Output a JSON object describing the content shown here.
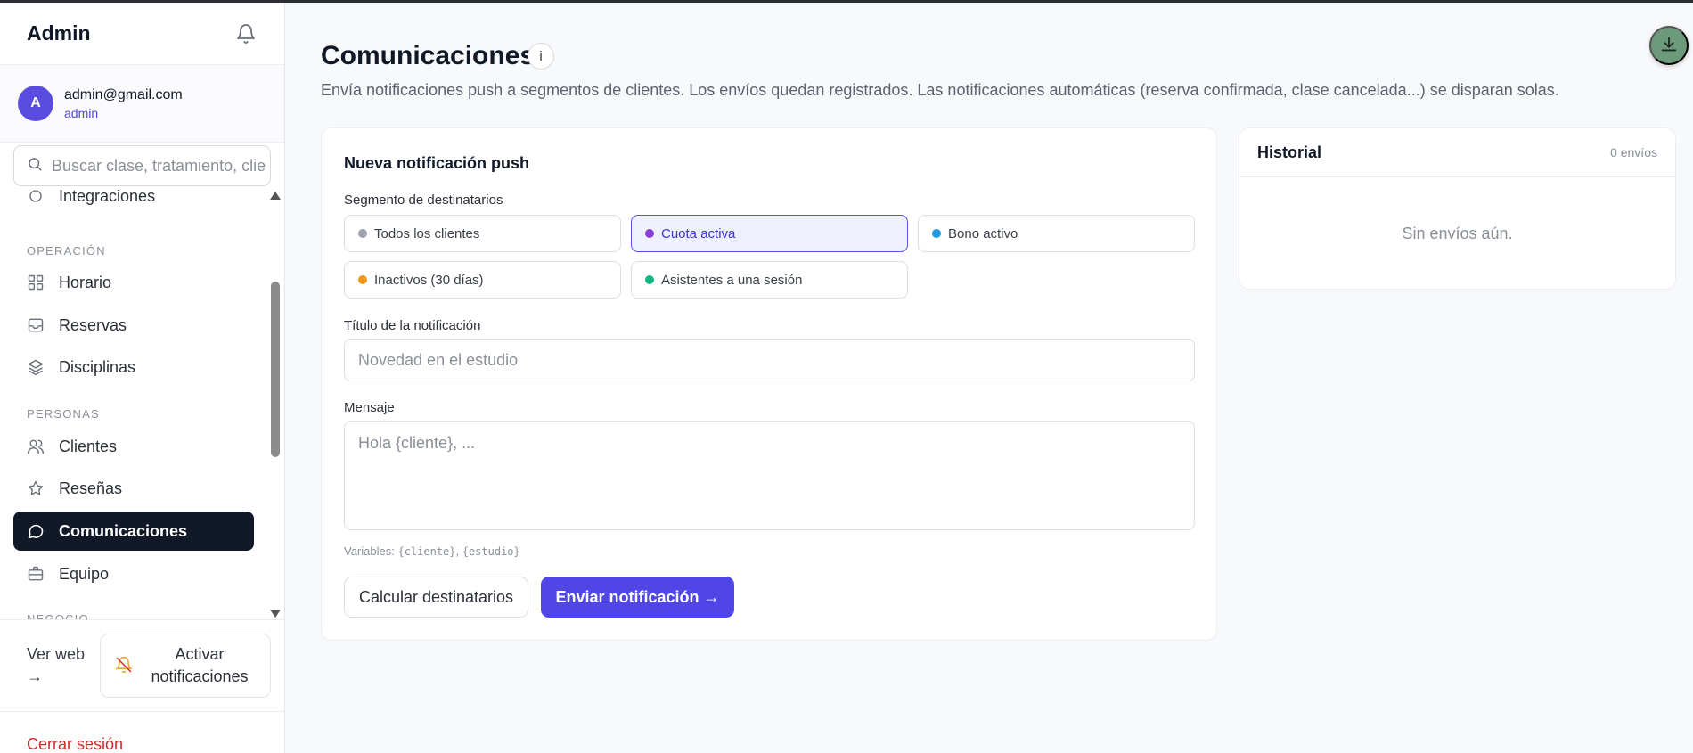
{
  "sidebar": {
    "title": "Admin",
    "user": {
      "initial": "A",
      "email": "admin@gmail.com",
      "role": "admin"
    },
    "search": {
      "placeholder": "Buscar clase, tratamiento, cliente"
    },
    "sections": {
      "operacion": "OPERACIÓN",
      "personas": "PERSONAS",
      "negocio": "NEGOCIO"
    },
    "items": {
      "integraciones": "Integraciones",
      "horario": "Horario",
      "reservas": "Reservas",
      "disciplinas": "Disciplinas",
      "clientes": "Clientes",
      "resenas": "Reseñas",
      "comunicaciones": "Comunicaciones",
      "equipo": "Equipo"
    },
    "active_item": "Comunicaciones",
    "footer": {
      "ver_web": "Ver web →",
      "activar": "Activar notificaciones",
      "logout": "Cerrar sesión"
    }
  },
  "header": {
    "title": "Comunicaciones",
    "info": "i",
    "description": "Envía notificaciones push a segmentos de clientes. Los envíos quedan registrados. Las notificaciones automáticas (reserva confirmada, clase cancelada...) se disparan solas."
  },
  "form": {
    "title": "Nueva notificación push",
    "segment_label": "Segmento de destinatarios",
    "segments": [
      {
        "label": "Todos los clientes",
        "color": "#9ca3af"
      },
      {
        "label": "Cuota activa",
        "color": "#8b3fd9",
        "selected": true
      },
      {
        "label": "Bono activo",
        "color": "#1e9be0"
      },
      {
        "label": "Inactivos (30 días)",
        "color": "#f0961a"
      },
      {
        "label": "Asistentes a una sesión",
        "color": "#10b981"
      }
    ],
    "title_label": "Título de la notificación",
    "title_placeholder": "Novedad en el estudio",
    "message_label": "Mensaje",
    "message_placeholder": "Hola {cliente}, ...",
    "vars_prefix": "Variables: ",
    "var_cliente": "{cliente}",
    "vars_sep": ", ",
    "var_estudio": "{estudio}",
    "calc_button": "Calcular destinatarios",
    "send_button": "Enviar notificación →"
  },
  "history": {
    "title": "Historial",
    "count": "0 envíos",
    "empty": "Sin envíos aún."
  },
  "colors": {
    "accent": "#4f46e5",
    "active_nav": "#111827",
    "logout": "#d42a2a",
    "fab": "#6d9a7a"
  },
  "icons": {
    "bell": "bell-icon",
    "search": "search-icon",
    "download": "download-icon",
    "bell_off": "bell-off-icon"
  }
}
